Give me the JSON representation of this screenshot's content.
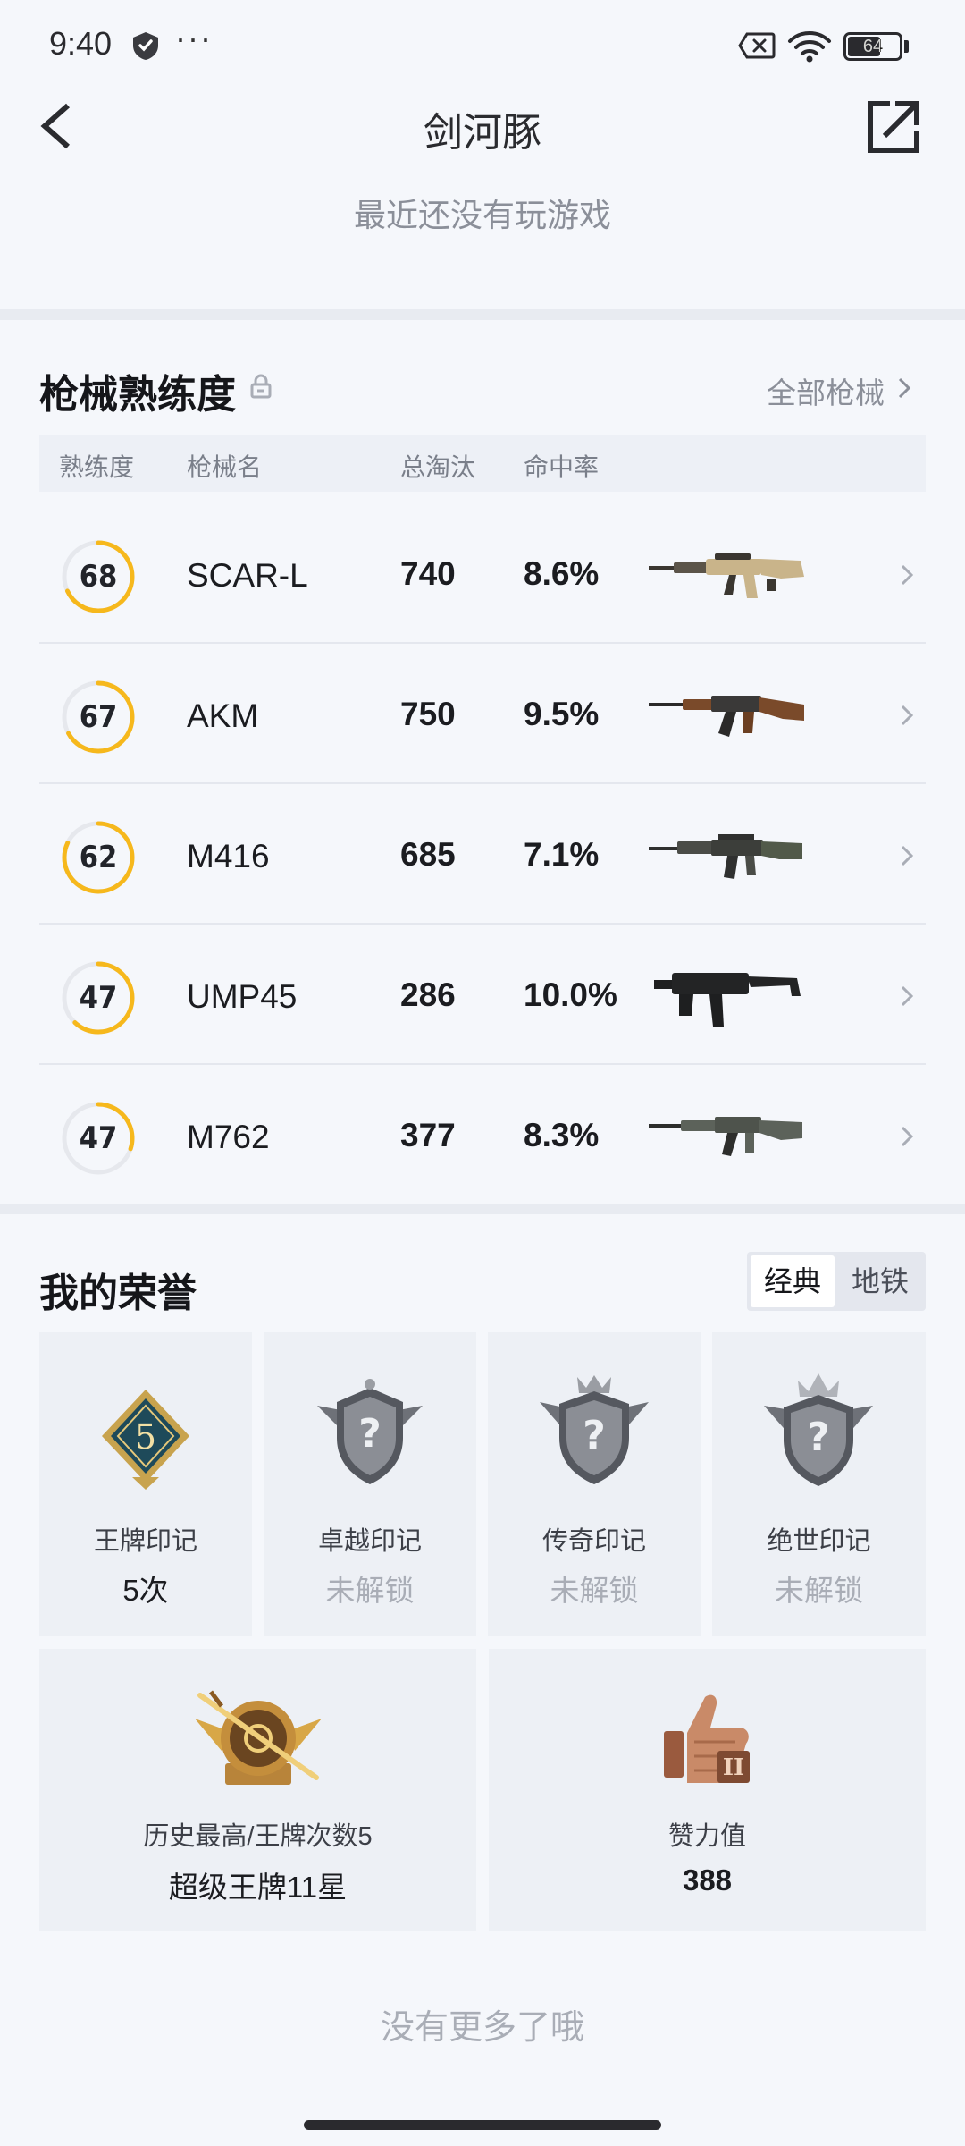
{
  "status_bar": {
    "time": "9:40",
    "dots": "···",
    "battery": "64",
    "battery_level": 0.64
  },
  "header": {
    "title": "剑河豚",
    "subtitle": "最近还没有玩游戏"
  },
  "weapons": {
    "title": "枪械熟练度",
    "all_link": "全部枪械",
    "columns": [
      "熟练度",
      "枪械名",
      "总淘汰",
      "命中率"
    ],
    "rows": [
      {
        "proficiency": "68",
        "name": "SCAR-L",
        "kills": "740",
        "hit_rate": "8.6%",
        "ring_progress": 0.68,
        "gun_icon": "scar-l-rifle-icon"
      },
      {
        "proficiency": "67",
        "name": "AKM",
        "kills": "750",
        "hit_rate": "9.5%",
        "ring_progress": 0.67,
        "gun_icon": "akm-rifle-icon"
      },
      {
        "proficiency": "62",
        "name": "M416",
        "kills": "685",
        "hit_rate": "7.1%",
        "ring_progress": 0.82,
        "gun_icon": "m416-rifle-icon"
      },
      {
        "proficiency": "47",
        "name": "UMP45",
        "kills": "286",
        "hit_rate": "10.0%",
        "ring_progress": 0.62,
        "gun_icon": "ump45-smg-icon"
      },
      {
        "proficiency": "47",
        "name": "M762",
        "kills": "377",
        "hit_rate": "8.3%",
        "ring_progress": 0.3,
        "gun_icon": "m762-rifle-icon"
      }
    ]
  },
  "honor": {
    "title": "我的荣誉",
    "modes": [
      "经典",
      "地铁"
    ],
    "active_mode": "经典",
    "badges": [
      {
        "label": "王牌印记",
        "value": "5次",
        "locked": false,
        "badge_number": "5"
      },
      {
        "label": "卓越印记",
        "value": "未解锁",
        "locked": true
      },
      {
        "label": "传奇印记",
        "value": "未解锁",
        "locked": true
      },
      {
        "label": "绝世印记",
        "value": "未解锁",
        "locked": true
      }
    ],
    "highlight": {
      "label": "历史最高/王牌次数5",
      "value": "超级王牌11星"
    },
    "likes": {
      "label": "赞力值",
      "value": "388"
    }
  },
  "footer": {
    "no_more": "没有更多了哦"
  },
  "colors": {
    "accent": "#f6b81c",
    "ring_track": "#e6e8ed",
    "muted": "#8b8f99"
  }
}
